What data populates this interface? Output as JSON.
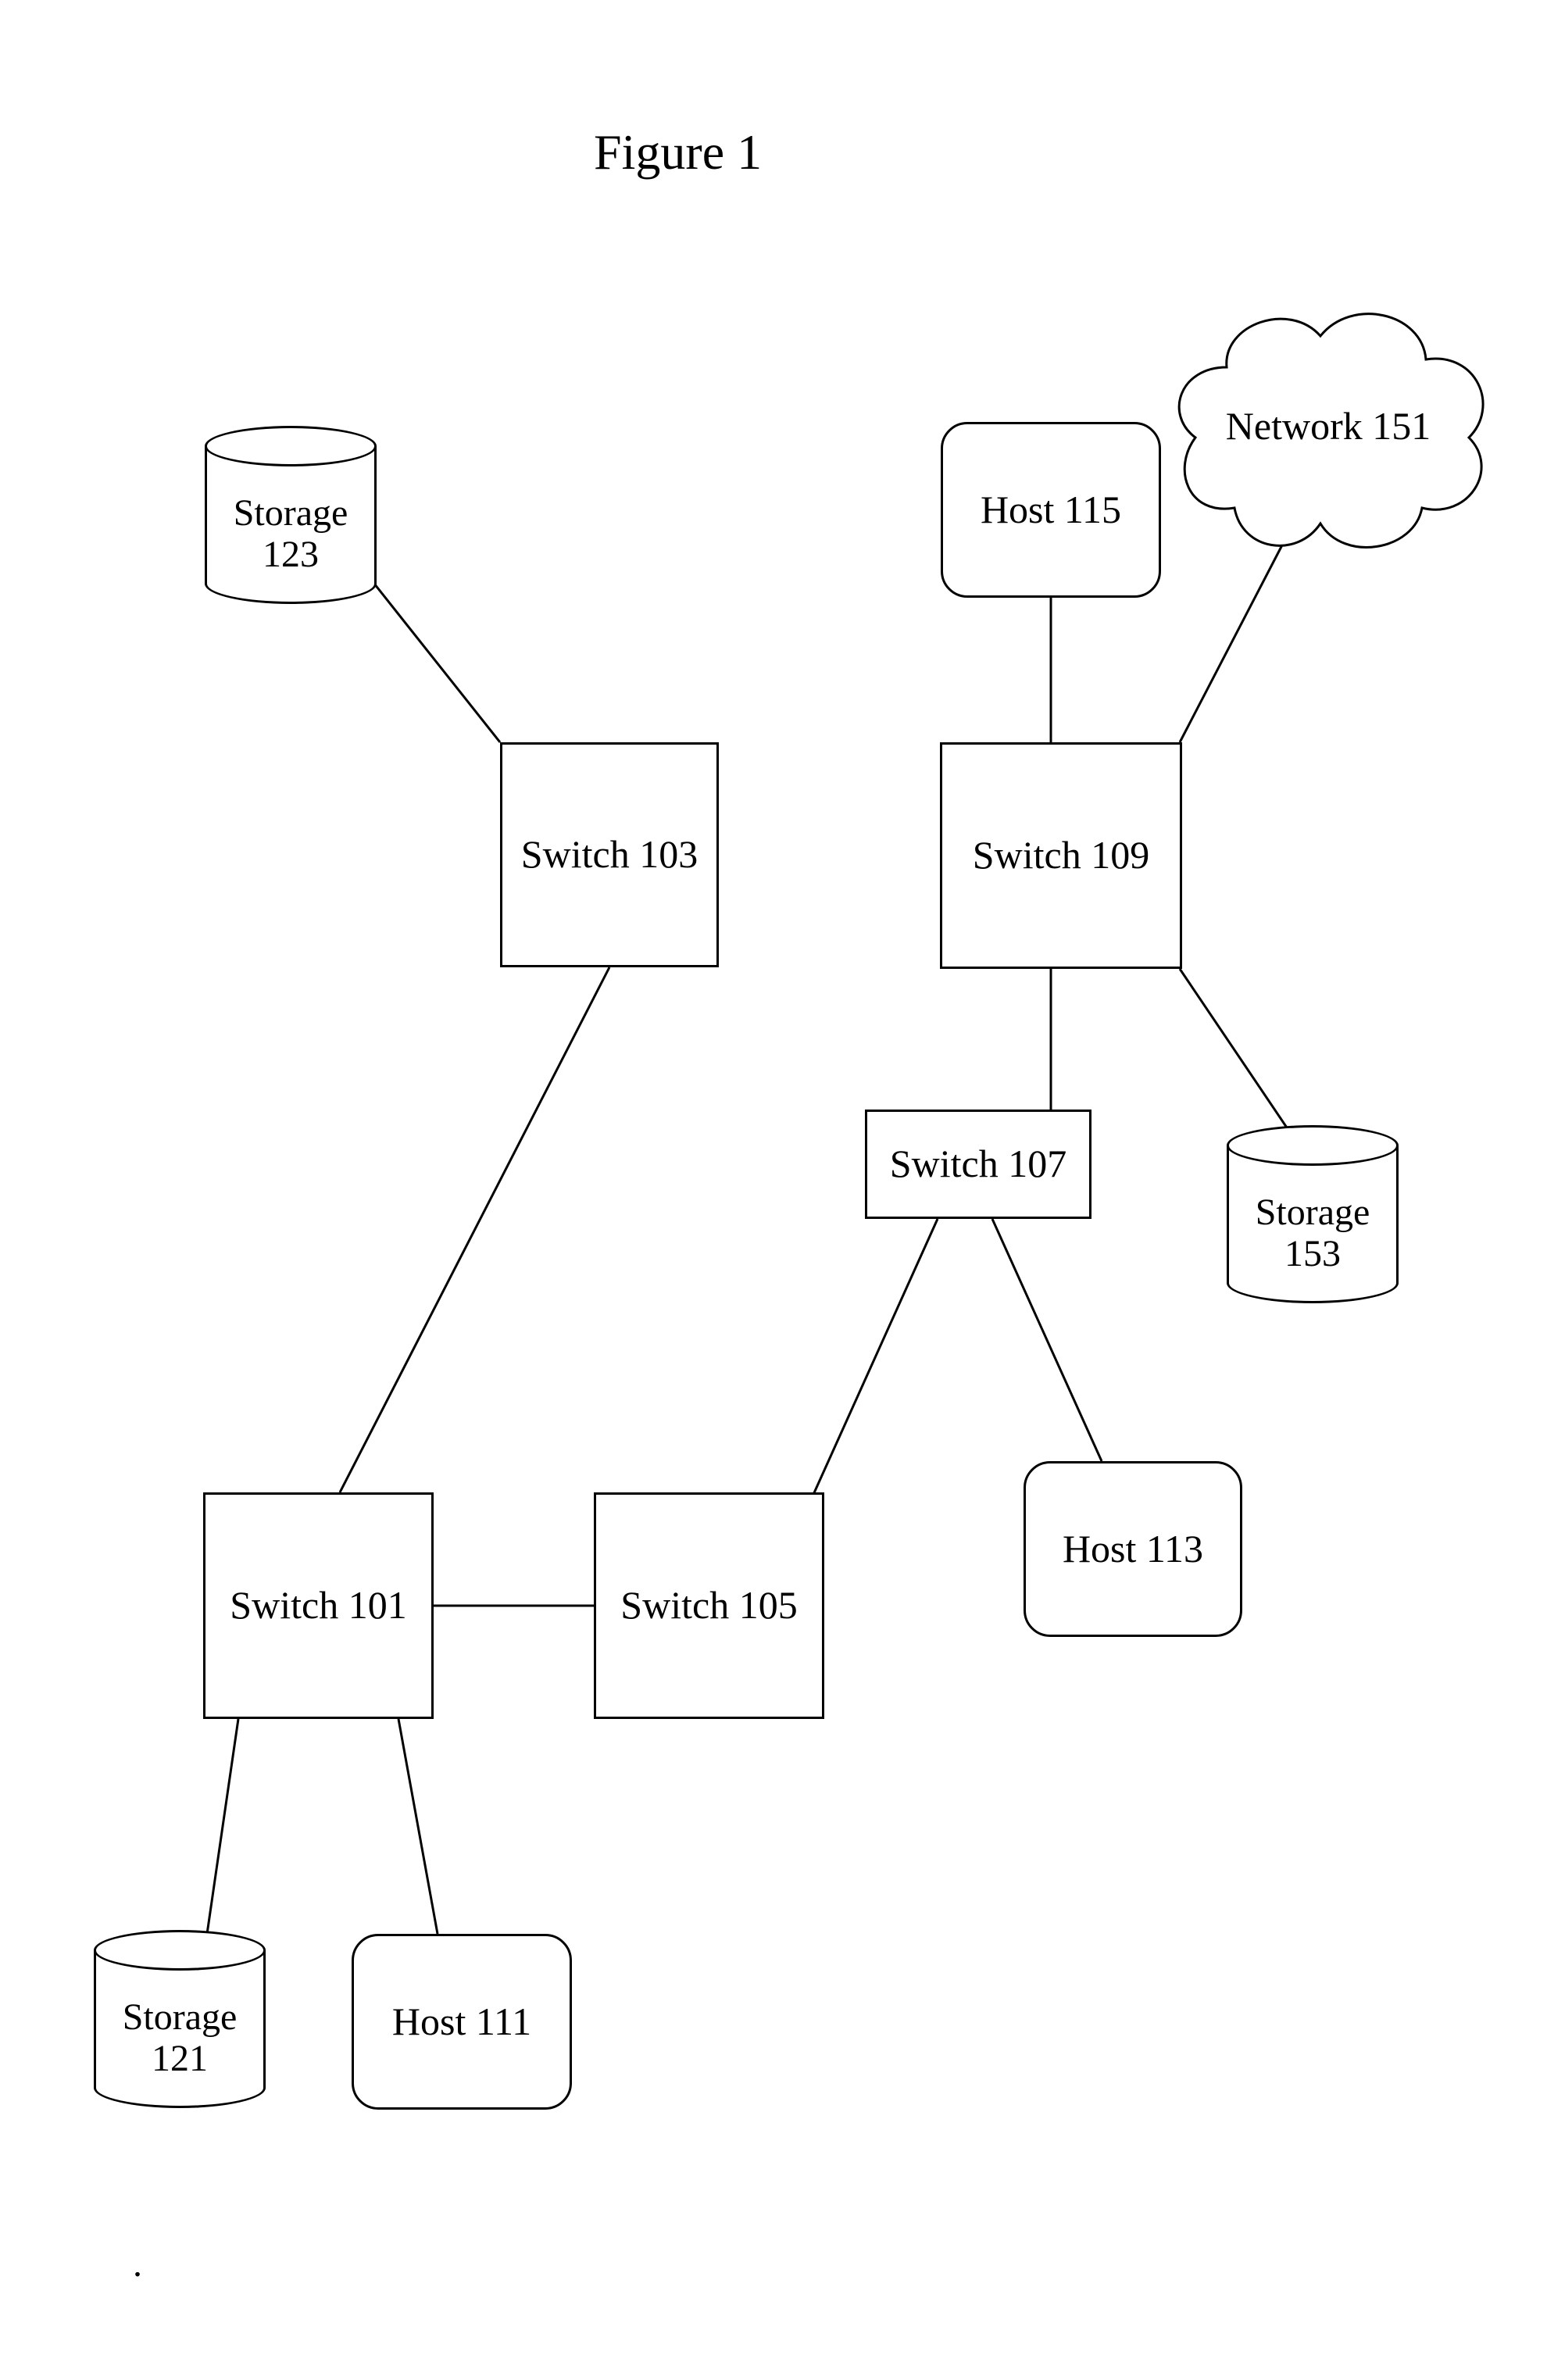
{
  "figure_title": "Figure 1",
  "nodes": {
    "switch101": "Switch 101",
    "switch103": "Switch 103",
    "switch105": "Switch 105",
    "switch107": "Switch 107",
    "switch109": "Switch 109",
    "host111": "Host 111",
    "host113": "Host 113",
    "host115": "Host 115",
    "storage121": "Storage\n121",
    "storage123": "Storage\n123",
    "storage153": "Storage\n153",
    "network151": "Network 151"
  },
  "dot_caption": "."
}
